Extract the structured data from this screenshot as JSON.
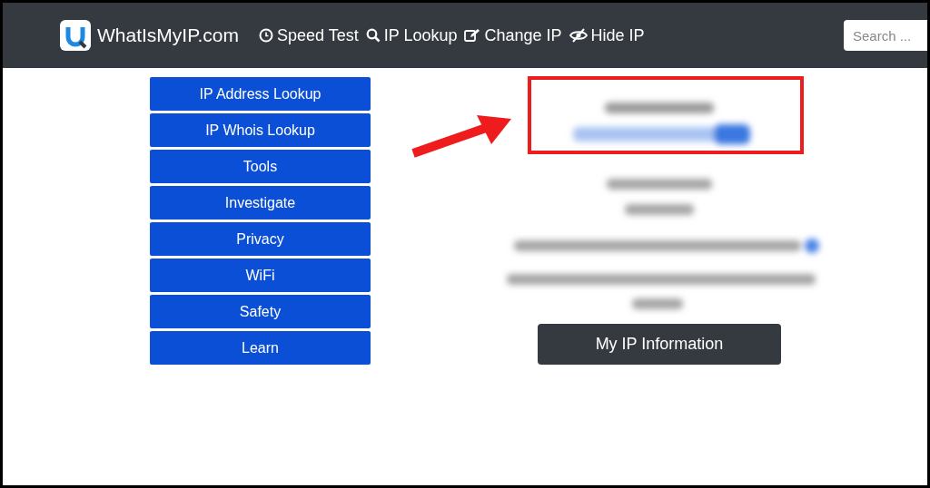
{
  "navbar": {
    "brand": "WhatIsMyIP.com",
    "links": [
      {
        "label": "Speed Test",
        "kind": "clock"
      },
      {
        "label": "IP Lookup",
        "kind": "search"
      },
      {
        "label": "Change IP",
        "kind": "edit"
      },
      {
        "label": "Hide IP",
        "kind": "eye"
      }
    ],
    "search": {
      "placeholder": "Search ..."
    }
  },
  "menu": [
    "IP Address Lookup",
    "IP Whois Lookup",
    "Tools",
    "Investigate",
    "Privacy",
    "WiFi",
    "Safety",
    "Learn"
  ],
  "info_button": "My IP Information"
}
